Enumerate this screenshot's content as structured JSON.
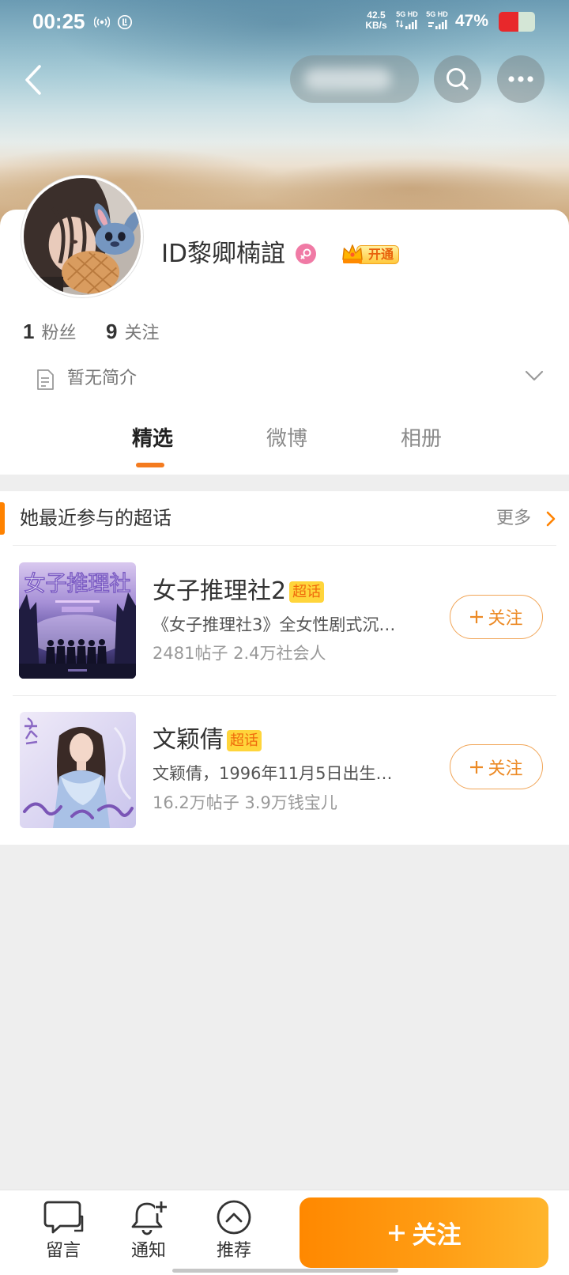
{
  "status_bar": {
    "time": "00:25",
    "net_speed_value": "42.5",
    "net_speed_unit": "KB/s",
    "sim1_label": "5G HD",
    "sim2_label": "5G HD",
    "battery_text": "47%",
    "icons": [
      "broadcast-icon",
      "app-notification-icon",
      "signal-icon",
      "signal-icon",
      "battery-icon"
    ]
  },
  "nav": {
    "icons": {
      "back": "chevron-left-icon",
      "search": "search-icon",
      "more": "more-dots-icon"
    }
  },
  "profile": {
    "name": "ID黎卿楠誼",
    "gender_icon": "female-icon",
    "vip_badge": "开通",
    "fans_count": "1",
    "fans_label": "粉丝",
    "following_count": "9",
    "following_label": "关注",
    "bio": "暂无简介"
  },
  "tabs": [
    {
      "label": "精选",
      "active": true
    },
    {
      "label": "微博",
      "active": false
    },
    {
      "label": "相册",
      "active": false
    }
  ],
  "supertopics": {
    "title": "她最近参与的超话",
    "more_label": "更多",
    "items": [
      {
        "title": "女子推理社2",
        "badge": "超话",
        "description": "《女子推理社3》全女性剧式沉…",
        "stats": "2481帖子 2.4万社会人",
        "follow_label": "关注",
        "poster_text": "女子推理社"
      },
      {
        "title": "文颖倩",
        "badge": "超话",
        "description": "文颖倩，1996年11月5日出生…",
        "stats": "16.2万帖子 3.9万钱宝儿",
        "follow_label": "关注"
      }
    ]
  },
  "bottom_bar": {
    "items": [
      {
        "label": "留言",
        "icon": "comment-icon"
      },
      {
        "label": "通知",
        "icon": "bell-plus-icon"
      },
      {
        "label": "推荐",
        "icon": "recommend-icon"
      }
    ],
    "follow_label": "关注"
  },
  "colors": {
    "accent": "#ff8200",
    "tab_indicator": "#f47b1f",
    "badge_yellow": "#ffd53b",
    "female": "#f07aa5",
    "text_primary": "#333333",
    "text_secondary": "#999999",
    "battery": "#e8282b"
  }
}
